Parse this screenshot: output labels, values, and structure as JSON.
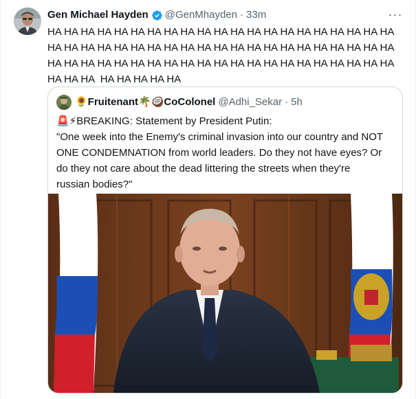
{
  "tweet": {
    "author_name": "Gen Michael Hayden",
    "handle": "@GenMhayden",
    "separator": "·",
    "time": "33m",
    "more_icon": "···",
    "text_lines": [
      "HA HA HA HA HA HA HA HA HA HA HA HA HA HA HA HA HA HA HA HA HA",
      "HA HA HA HA HA HA HA HA HA HA HA HA HA HA HA HA HA HA HA HA HA",
      "HA HA HA HA HA HA HA HA HA HA HA HA HA HA HA HA HA HA HA HA HA",
      "HA HA HA  HA HA HA HA HA"
    ]
  },
  "quote": {
    "author_name": "🌻Fruitenant🌴🥥CoColonel",
    "handle": "@Adhi_Sekar",
    "separator": "·",
    "time": "5h",
    "text_lines": [
      "🚨⚡BREAKING: Statement by President Putin:",
      "\"One week into the Enemy's criminal invasion into our country and NOT",
      "ONE CONDEMNATION from world leaders. Do they not have eyes? Or",
      "do they not care about the dead littering the streets when they're",
      "russian bodies?\""
    ]
  },
  "colors": {
    "text": "#0f1419",
    "secondary": "#536471",
    "verified": "#1d9bf0",
    "border": "#cfd9de"
  }
}
